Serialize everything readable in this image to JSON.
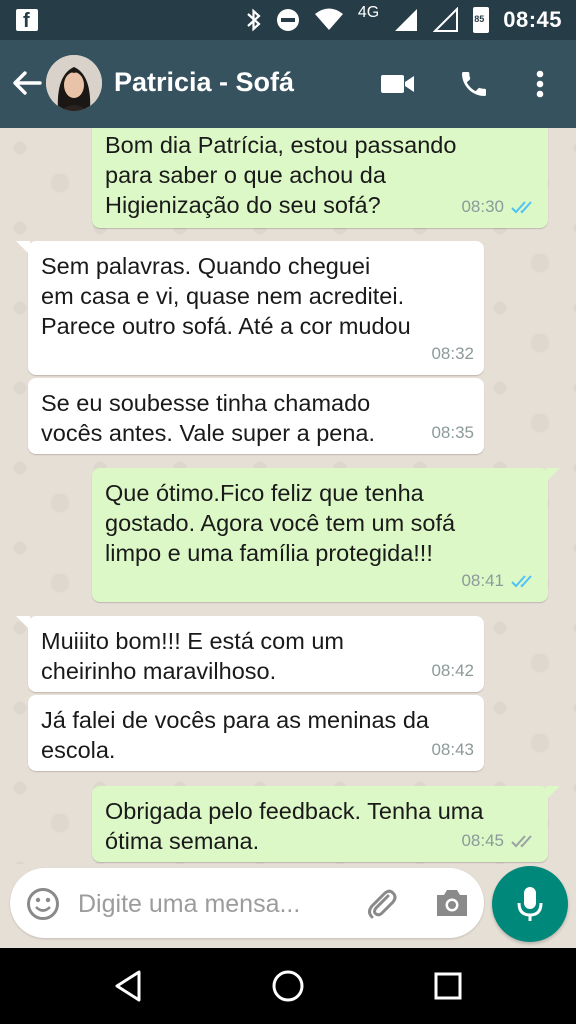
{
  "status_bar": {
    "network": "4G",
    "battery": "85",
    "time": "08:45"
  },
  "header": {
    "contact_name": "Patricia - Sofá"
  },
  "messages": [
    {
      "direction": "out",
      "text": "Bom dia Patrícia, estou passando\npara saber o que achou da\nHigienização do seu sofá?",
      "time": "08:30",
      "status": "read"
    },
    {
      "direction": "in",
      "text": "Sem palavras. Quando cheguei\nem casa e vi, quase nem acreditei.\nParece outro sofá. Até a cor mudou",
      "time": "08:32"
    },
    {
      "direction": "in",
      "text": "Se eu soubesse tinha chamado\nvocês antes. Vale super a pena.",
      "time": "08:35"
    },
    {
      "direction": "out",
      "text": "Que ótimo.Fico feliz que tenha\ngostado. Agora  você tem um sofá\nlimpo e uma família protegida!!!",
      "time": "08:41",
      "status": "read"
    },
    {
      "direction": "in",
      "text": "Muiiito bom!!! E está com um\ncheirinho maravilhoso.",
      "time": "08:42"
    },
    {
      "direction": "in",
      "text": "Já falei de vocês para as meninas da\nescola.",
      "time": "08:43"
    },
    {
      "direction": "out",
      "text": "Obrigada pelo feedback. Tenha uma\nótima semana.",
      "time": "08:45",
      "status": "delivered"
    }
  ],
  "composer": {
    "placeholder": "Digite uma mensa..."
  },
  "colors": {
    "header": "#36525f",
    "status_bar": "#263c47",
    "outgoing_bubble": "#dcf8c6",
    "incoming_bubble": "#ffffff",
    "read_ticks": "#4fc3f7",
    "mic_button": "#00897b"
  },
  "icons": [
    "facebook-icon",
    "bluetooth-icon",
    "do-not-disturb-icon",
    "wifi-icon",
    "signal-icon",
    "battery-icon",
    "back-arrow-icon",
    "video-call-icon",
    "phone-icon",
    "more-vert-icon",
    "emoji-icon",
    "attach-icon",
    "camera-icon",
    "mic-icon",
    "nav-back-icon",
    "nav-home-icon",
    "nav-recents-icon"
  ]
}
